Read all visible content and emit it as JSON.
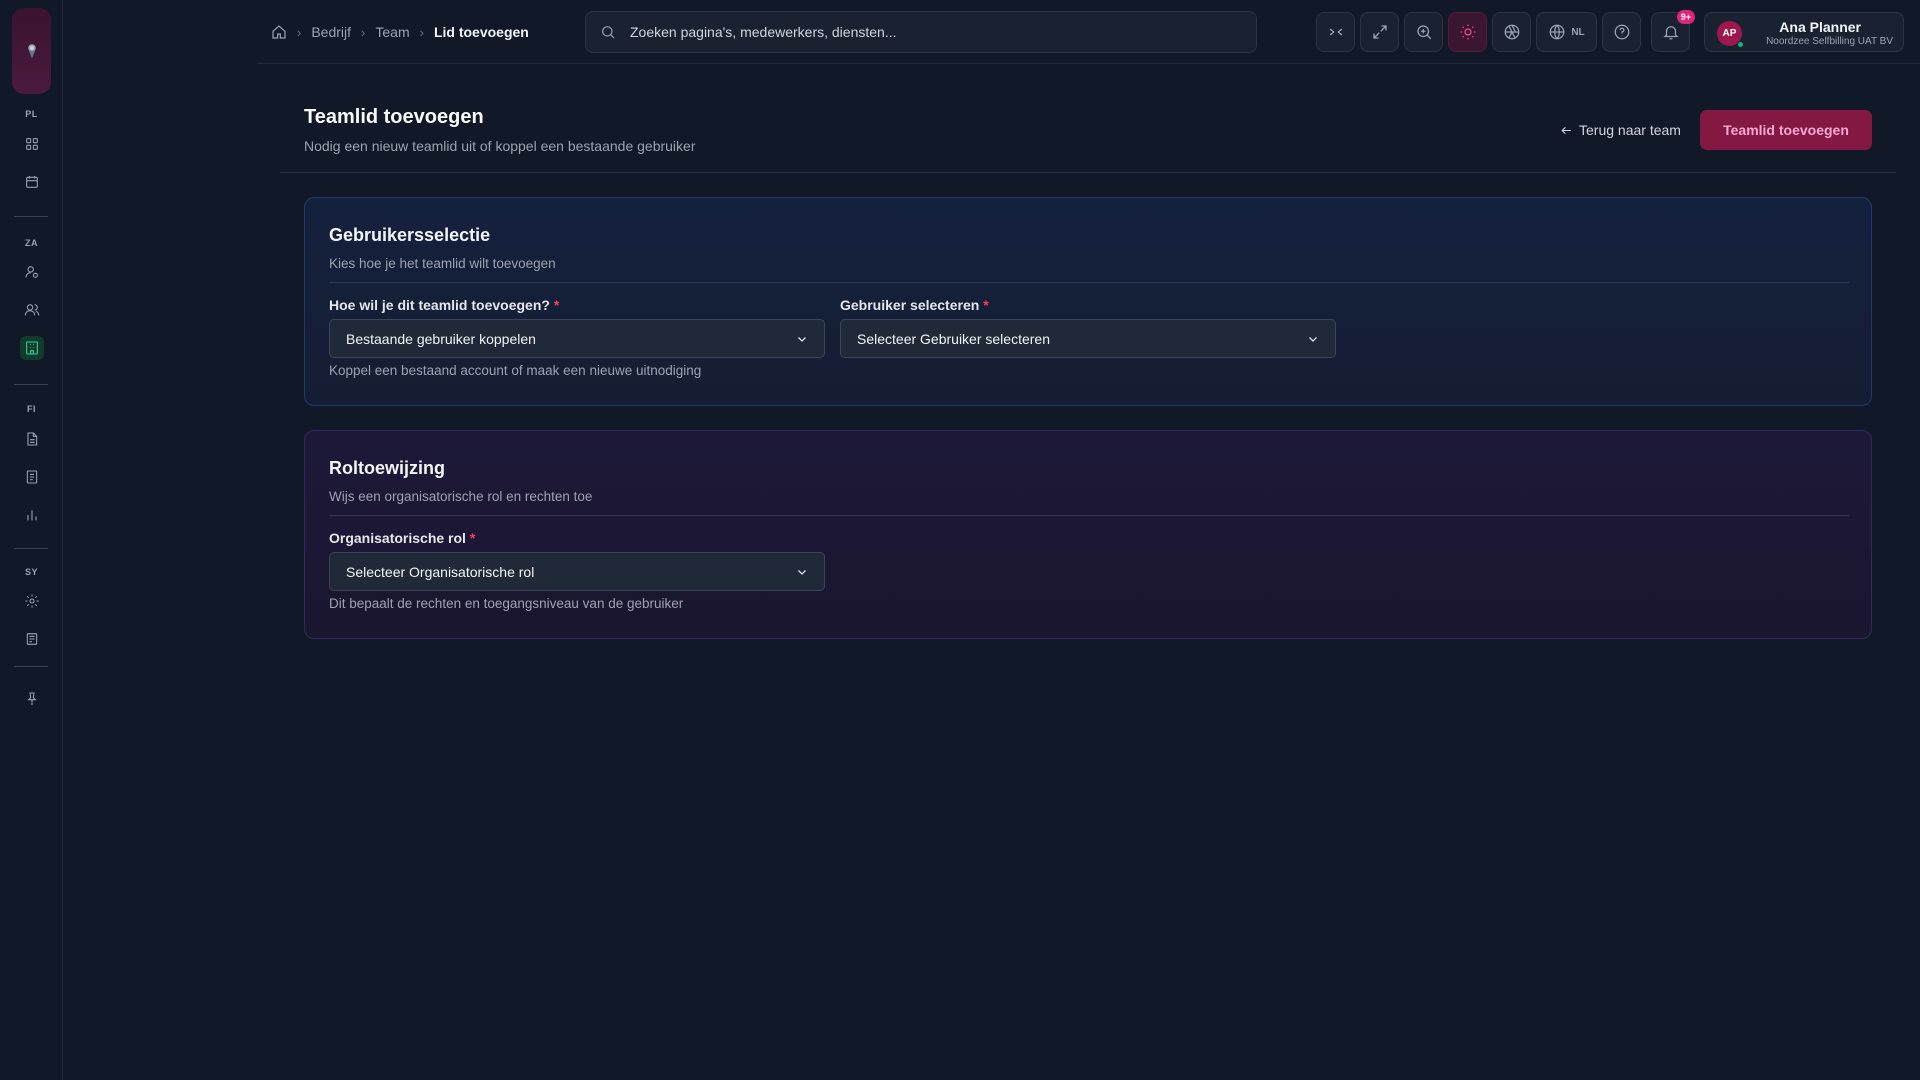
{
  "sidebar": {
    "sections": [
      "PL",
      "ZA",
      "FI",
      "SY"
    ],
    "items": [
      {
        "icon": "dashboard-icon"
      },
      {
        "icon": "calendar-icon"
      },
      {
        "icon": "user-cog-icon"
      },
      {
        "icon": "users-icon"
      },
      {
        "icon": "building-icon",
        "active": true
      },
      {
        "icon": "document-icon"
      },
      {
        "icon": "invoice-icon"
      },
      {
        "icon": "bar-chart-icon"
      },
      {
        "icon": "gear-icon"
      },
      {
        "icon": "logs-icon"
      },
      {
        "icon": "pin-icon"
      }
    ]
  },
  "breadcrumb": {
    "items": [
      "Bedrijf",
      "Team"
    ],
    "current": "Lid toevoegen"
  },
  "search": {
    "placeholder": "Zoeken pagina's, medewerkers, diensten..."
  },
  "header": {
    "language": "NL",
    "notifications_badge": "9+",
    "user": {
      "initials": "AP",
      "name": "Ana Planner",
      "company": "Noordzee Selfbilling UAT BV"
    }
  },
  "page": {
    "title": "Teamlid toevoegen",
    "subtitle": "Nodig een nieuw teamlid uit of koppel een bestaande gebruiker",
    "back_label": "Terug naar team",
    "primary_label": "Teamlid toevoegen"
  },
  "user_selection": {
    "title": "Gebruikersselectie",
    "subtitle": "Kies hoe je het teamlid wilt toevoegen",
    "method_label": "Hoe wil je dit teamlid toevoegen?",
    "method_value": "Bestaande gebruiker koppelen",
    "method_help": "Koppel een bestaand account of maak een nieuwe uitnodiging",
    "user_label": "Gebruiker selecteren",
    "user_value": "Selecteer Gebruiker selecteren"
  },
  "role_assignment": {
    "title": "Roltoewijzing",
    "subtitle": "Wijs een organisatorische rol en rechten toe",
    "role_label": "Organisatorische rol",
    "role_value": "Selecteer Organisatorische rol",
    "role_help": "Dit bepaalt de rechten en toegangsniveau van de gebruiker"
  },
  "colors": {
    "accent": "#831843",
    "accent_text": "#f9a8d4",
    "background": "#111827",
    "active_nav": "#34d399"
  }
}
